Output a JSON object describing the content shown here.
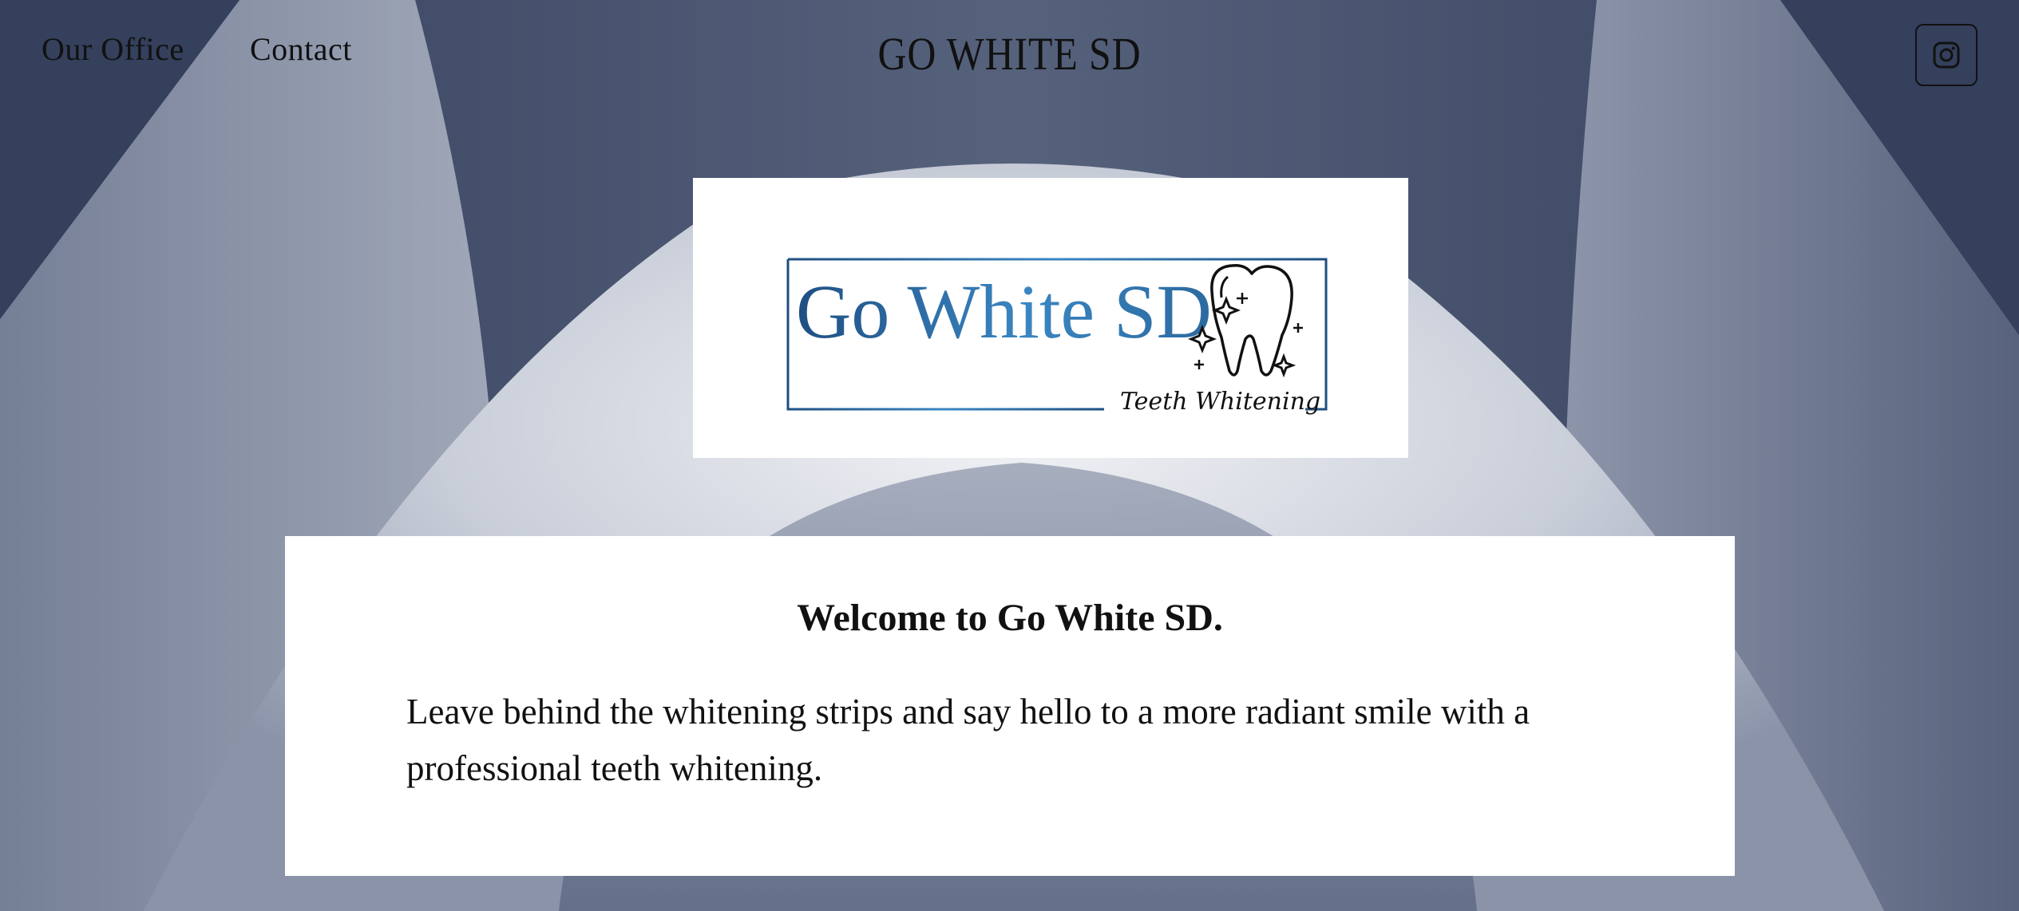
{
  "header": {
    "nav": [
      {
        "label": "Our Office"
      },
      {
        "label": "Contact"
      }
    ],
    "site_title": "GO WHITE SD",
    "social_icon": "instagram-icon"
  },
  "logo": {
    "wordmark": "Go White SD",
    "tagline": "Teeth Whitening",
    "icon": "tooth-sparkle-icon",
    "colors": {
      "wordmark_start": "#1f4f82",
      "wordmark_end": "#3a86c2",
      "frame": "#1f4f82"
    }
  },
  "welcome": {
    "heading": "Welcome to Go White SD.",
    "body": "Leave behind the whitening strips and say hello to a more radiant smile with a professional teeth whitening."
  },
  "colors": {
    "background_dark": "#3d4a66",
    "background_light": "#e6e8ee",
    "card": "#ffffff",
    "text": "#111111"
  }
}
